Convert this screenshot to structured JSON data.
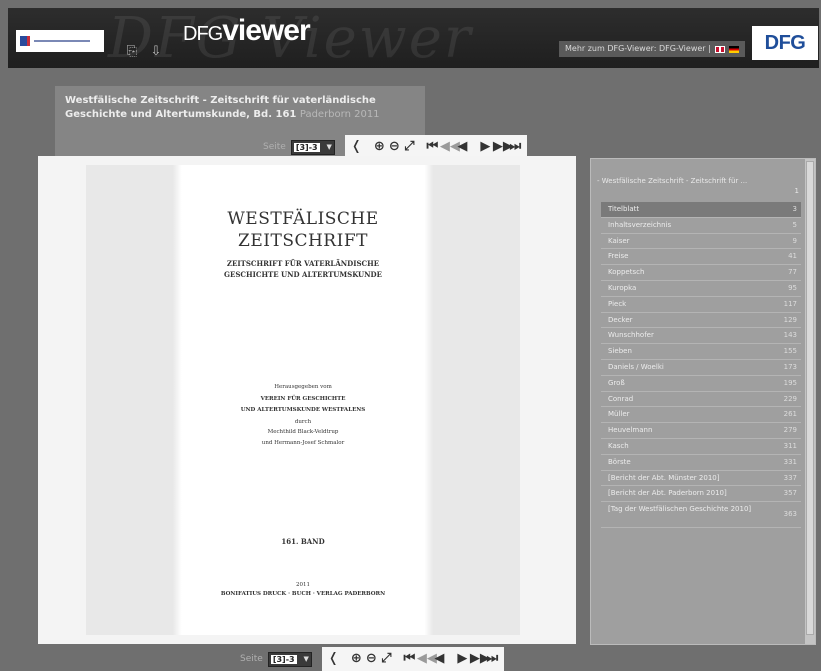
{
  "header": {
    "brand_prefix": "DFG",
    "brand_name": "viewer",
    "brand_watermark": "DFG Viewer",
    "link_text": "Mehr zum DFG-Viewer: DFG-Viewer |",
    "dfg_logo": "DFG",
    "tool_icons": [
      "export-icon",
      "download-icon"
    ]
  },
  "document": {
    "title": "Westfälische Zeitschrift - Zeitschrift für vaterländische Geschichte und Altertumskunde, Bd. 161",
    "title_place_year": "Paderborn 2011"
  },
  "toolbar": {
    "seite_label": "Seite",
    "page_value": "[3]-3",
    "select_arrow": "▼",
    "icons": {
      "collapse": "❬",
      "zoom_in": "⊕",
      "zoom_out": "⊖",
      "fullscreen": "⤢",
      "first": "⏮",
      "back_fast": "◀◀",
      "back": "◀",
      "forward": "▶",
      "forward_fast": "▶▶",
      "last": "⏭"
    }
  },
  "page_image": {
    "title_line1": "WESTFÄLISCHE",
    "title_line2": "ZEITSCHRIFT",
    "subtitle_line1": "ZEITSCHRIFT FÜR VATERLÄNDISCHE",
    "subtitle_line2": "GESCHICHTE UND ALTERTUMSKUNDE",
    "publisher_line1": "Herausgegeben vom",
    "publisher_line2": "VEREIN FÜR GESCHICHTE",
    "publisher_line3": "UND ALTERTUMSKUNDE WESTFALENS",
    "publisher_line4": "durch",
    "publisher_line5": "Mechthild Black-Veldtrup",
    "publisher_line6": "und Hermann-Josef Schmalor",
    "volume": "161. BAND",
    "year": "2011",
    "printer": "BONIFATIUS DRUCK · BUCH · VERLAG PADERBORN"
  },
  "toc": {
    "root_label": "- Westfälische Zeitschrift - Zeitschrift für ...",
    "root_page": "1",
    "items": [
      {
        "label": "Titelblatt",
        "page": "3"
      },
      {
        "label": "Inhaltsverzeichnis",
        "page": "5"
      },
      {
        "label": "Kaiser",
        "page": "9"
      },
      {
        "label": "Freise",
        "page": "41"
      },
      {
        "label": "Koppetsch",
        "page": "77"
      },
      {
        "label": "Kuropka",
        "page": "95"
      },
      {
        "label": "Pieck",
        "page": "117"
      },
      {
        "label": "Decker",
        "page": "129"
      },
      {
        "label": "Wunschhofer",
        "page": "143"
      },
      {
        "label": "Sieben",
        "page": "155"
      },
      {
        "label": "Daniels / Woelki",
        "page": "173"
      },
      {
        "label": "Groß",
        "page": "195"
      },
      {
        "label": "Conrad",
        "page": "229"
      },
      {
        "label": "Müller",
        "page": "261"
      },
      {
        "label": "Heuvelmann",
        "page": "279"
      },
      {
        "label": "Kasch",
        "page": "311"
      },
      {
        "label": "Börste",
        "page": "331"
      },
      {
        "label": "[Bericht der Abt. Münster 2010]",
        "page": "337"
      },
      {
        "label": "[Bericht der Abt. Paderborn 2010]",
        "page": "357"
      },
      {
        "label": "[Tag der Westfälischen Geschichte 2010]",
        "page": "363"
      }
    ]
  }
}
